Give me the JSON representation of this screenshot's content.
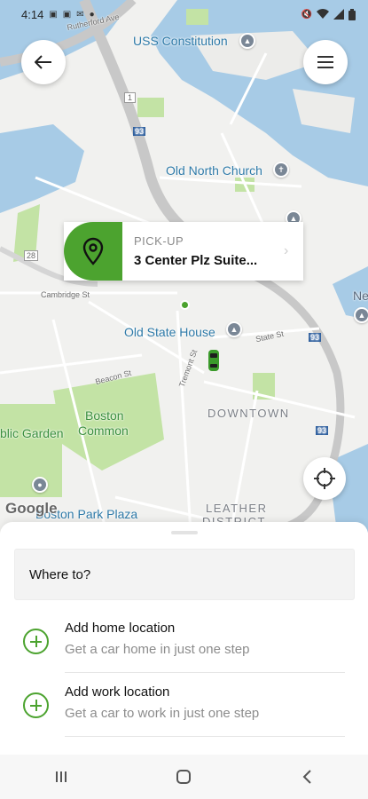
{
  "status_bar": {
    "time": "4:14",
    "left_icons": [
      "gallery-icon",
      "image-icon",
      "gmail-icon",
      "dot-icon"
    ],
    "right_icons": [
      "mute-icon",
      "wifi-icon",
      "signal-icon",
      "battery-icon"
    ]
  },
  "map": {
    "labels": {
      "uss_constitution": "USS Constitution",
      "old_north_church": "Old North Church",
      "old_state_house": "Old State House",
      "boston_common_1": "Boston",
      "boston_common_2": "Common",
      "public_garden": "blic Garden",
      "downtown": "DOWNTOWN",
      "boston_park_plaza": "Boston Park Plaza",
      "leather_district_1": "LEATHER",
      "leather_district_2": "DISTRICT",
      "rutherford_ave": "Rutherford Ave",
      "cambridge_st": "Cambridge St",
      "state_st": "State St",
      "beacon_st": "Beacon St",
      "tremont_st": "Tremont St",
      "edge_label": "Ne",
      "route_1": "1",
      "route_93a": "93",
      "route_28": "28",
      "route_93b": "93",
      "route_93c": "93"
    },
    "google_attribution": "Google"
  },
  "pickup": {
    "title": "PICK-UP",
    "address": "3 Center Plz Suite..."
  },
  "sheet": {
    "where_to": "Where to?",
    "home": {
      "title": "Add home location",
      "subtitle": "Get a car home in just one step"
    },
    "work": {
      "title": "Add work location",
      "subtitle": "Get a car to work in just one step"
    }
  },
  "colors": {
    "accent": "#4ca32f",
    "water": "#a7cbe6",
    "park": "#c3e3a5"
  }
}
